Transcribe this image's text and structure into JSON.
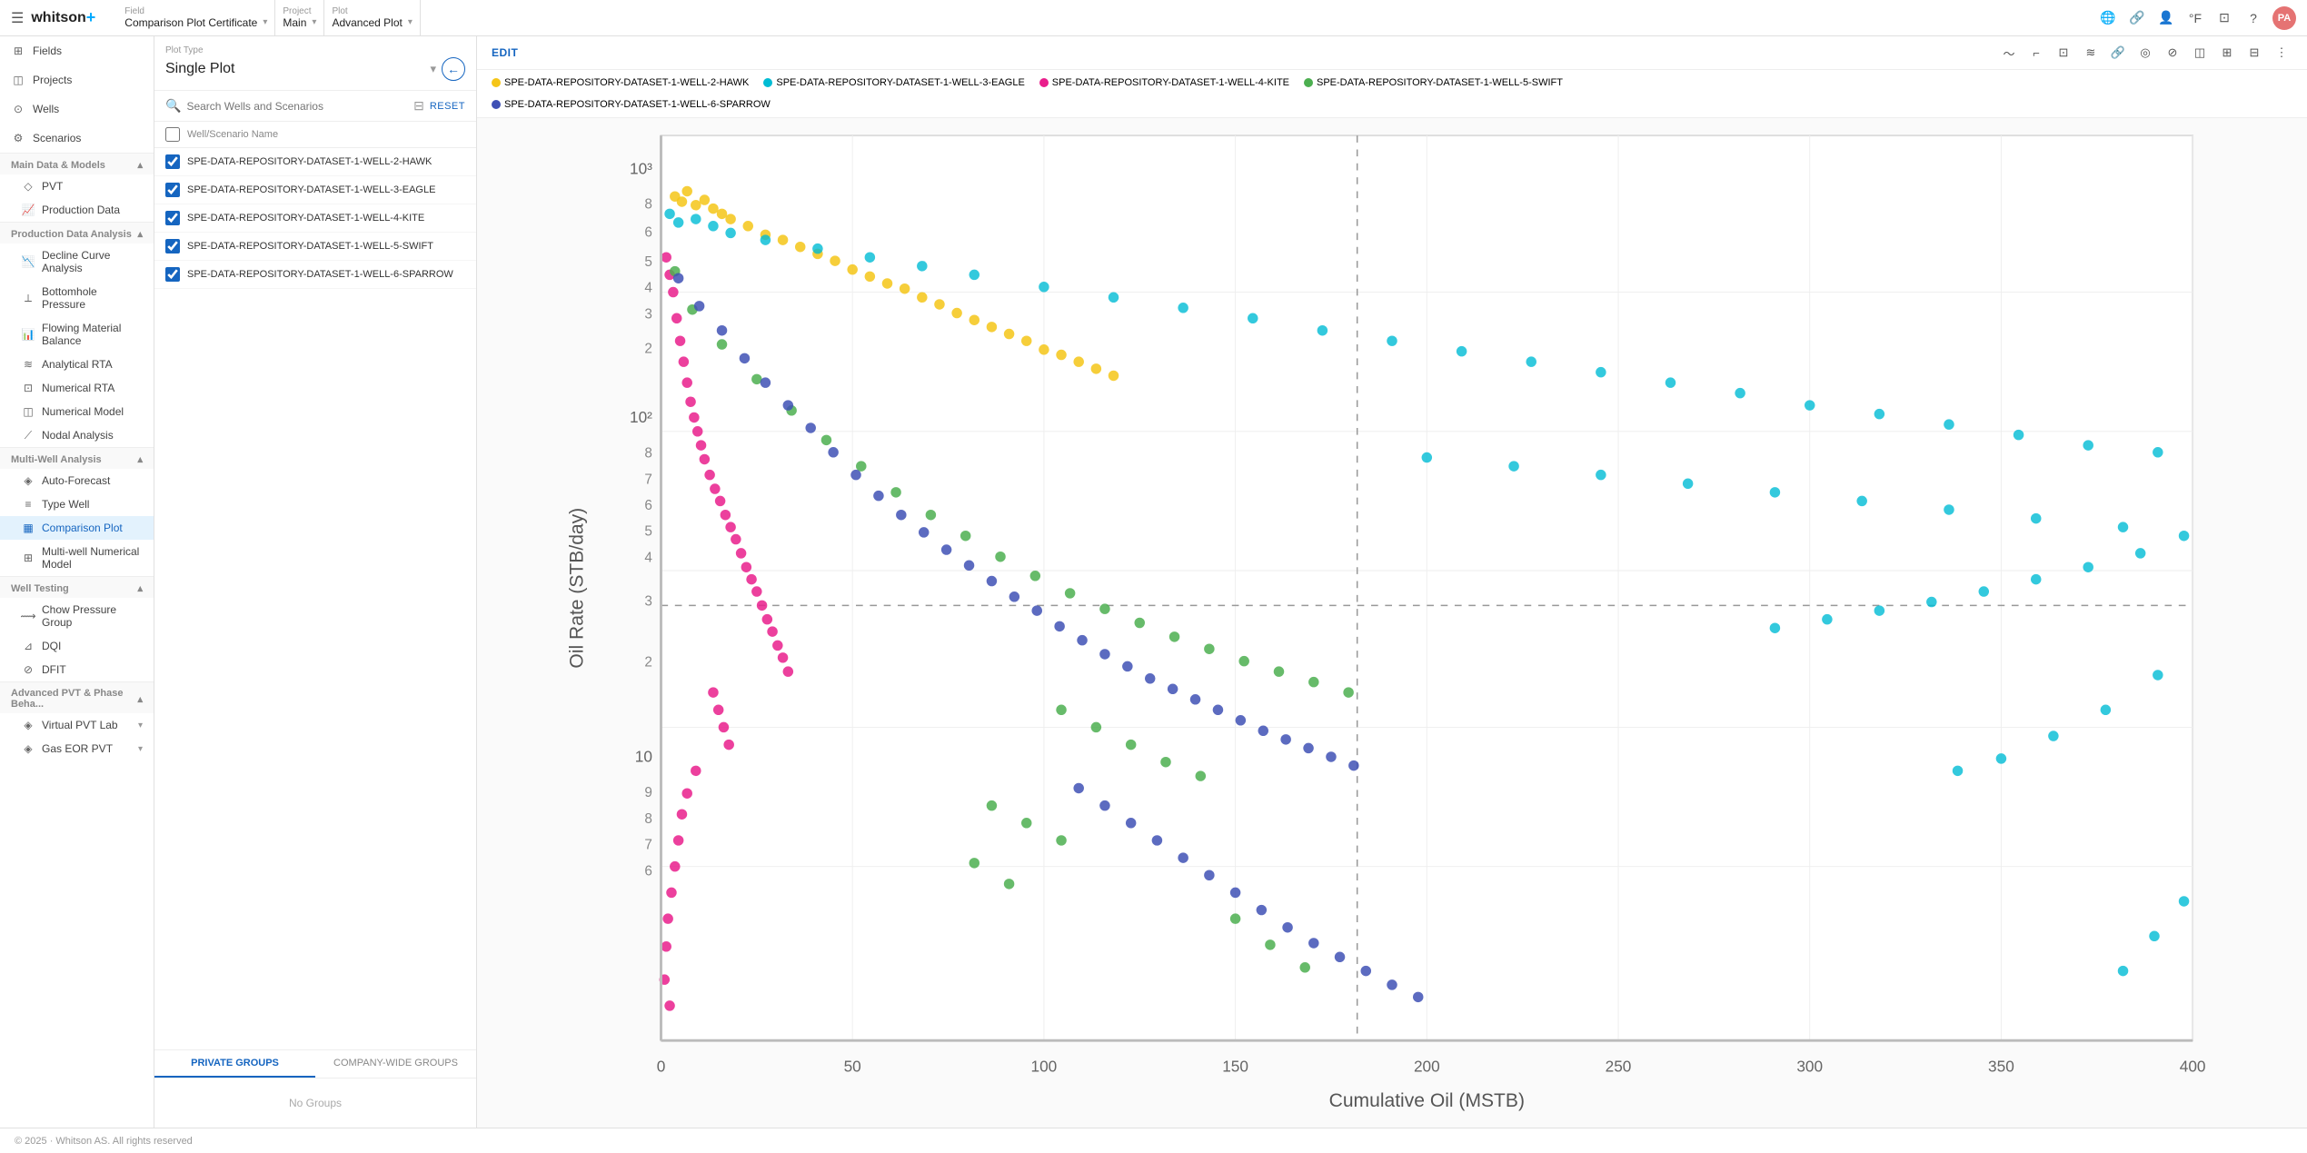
{
  "header": {
    "menu_icon": "☰",
    "logo": "whitson",
    "logo_plus": "+",
    "breadcrumbs": [
      {
        "label": "Field",
        "value": "Comparison Plot Certificate",
        "id": "field"
      },
      {
        "label": "Project",
        "value": "Main",
        "id": "project"
      },
      {
        "label": "Plot",
        "value": "Advanced Plot",
        "id": "plot"
      }
    ],
    "icons": [
      "🌐",
      "🔗",
      "👤",
      "℉",
      "☐",
      "❓"
    ],
    "avatar": "PA"
  },
  "sidebar": {
    "top_items": [
      {
        "label": "Fields",
        "icon": "⊞",
        "id": "fields"
      },
      {
        "label": "Projects",
        "icon": "📁",
        "id": "projects"
      },
      {
        "label": "Wells",
        "icon": "⊙",
        "id": "wells"
      },
      {
        "label": "Scenarios",
        "icon": "⚙",
        "id": "scenarios"
      }
    ],
    "groups": [
      {
        "label": "Main Data & Models",
        "items": [
          {
            "label": "PVT",
            "icon": "◇",
            "id": "pvt"
          },
          {
            "label": "Production Data",
            "icon": "📈",
            "id": "production-data"
          }
        ]
      },
      {
        "label": "Production Data Analysis",
        "items": [
          {
            "label": "Decline Curve Analysis",
            "icon": "📉",
            "id": "decline-curve"
          },
          {
            "label": "Bottomhole Pressure",
            "icon": "⟂",
            "id": "bottomhole-pressure"
          },
          {
            "label": "Flowing Material Balance",
            "icon": "📊",
            "id": "flowing-material-balance"
          },
          {
            "label": "Analytical RTA",
            "icon": "≋",
            "id": "analytical-rta"
          },
          {
            "label": "Numerical RTA",
            "icon": "⊡",
            "id": "numerical-rta"
          },
          {
            "label": "Numerical Model",
            "icon": "◫",
            "id": "numerical-model"
          },
          {
            "label": "Nodal Analysis",
            "icon": "⟋",
            "id": "nodal-analysis"
          }
        ]
      },
      {
        "label": "Multi-Well Analysis",
        "items": [
          {
            "label": "Auto-Forecast",
            "icon": "◈",
            "id": "auto-forecast"
          },
          {
            "label": "Type Well",
            "icon": "≡",
            "id": "type-well"
          },
          {
            "label": "Comparison Plot",
            "icon": "▦",
            "id": "comparison-plot",
            "active": true
          },
          {
            "label": "Multi-well Numerical Model",
            "icon": "⊞",
            "id": "multi-well-numerical"
          }
        ]
      },
      {
        "label": "Well Testing",
        "items": [
          {
            "label": "Chow Pressure Group",
            "icon": "⟿",
            "id": "chow-pressure"
          },
          {
            "label": "DQI",
            "icon": "⊿",
            "id": "dqi"
          },
          {
            "label": "DFIT",
            "icon": "⊘",
            "id": "dfit"
          }
        ]
      },
      {
        "label": "Advanced PVT & Phase Beha...",
        "items": [
          {
            "label": "Virtual PVT Lab",
            "icon": "◈",
            "id": "virtual-pvt",
            "collapsible": true
          },
          {
            "label": "Gas EOR PVT",
            "icon": "◈",
            "id": "gas-eor",
            "collapsible": true
          }
        ]
      }
    ]
  },
  "middle_panel": {
    "plot_type_label": "Plot Type",
    "plot_type_value": "Single Plot",
    "search_placeholder": "Search Wells and Scenarios",
    "reset_label": "RESET",
    "well_col_header": "Well/Scenario Name",
    "wells": [
      {
        "name": "SPE-DATA-REPOSITORY-DATASET-1-WELL-2-HAWK",
        "checked": true
      },
      {
        "name": "SPE-DATA-REPOSITORY-DATASET-1-WELL-3-EAGLE",
        "checked": true
      },
      {
        "name": "SPE-DATA-REPOSITORY-DATASET-1-WELL-4-KITE",
        "checked": true
      },
      {
        "name": "SPE-DATA-REPOSITORY-DATASET-1-WELL-5-SWIFT",
        "checked": true
      },
      {
        "name": "SPE-DATA-REPOSITORY-DATASET-1-WELL-6-SPARROW",
        "checked": true
      }
    ],
    "groups_tabs": [
      {
        "label": "PRIVATE GROUPS",
        "active": true
      },
      {
        "label": "COMPANY-WIDE GROUPS",
        "active": false
      }
    ],
    "no_groups_text": "No Groups"
  },
  "chart": {
    "edit_label": "EDIT",
    "legend": [
      {
        "label": "SPE-DATA-REPOSITORY-DATASET-1-WELL-2-HAWK",
        "color": "#f5c518"
      },
      {
        "label": "SPE-DATA-REPOSITORY-DATASET-1-WELL-3-EAGLE",
        "color": "#00bcd4"
      },
      {
        "label": "SPE-DATA-REPOSITORY-DATASET-1-WELL-4-KITE",
        "color": "#e91e8c"
      },
      {
        "label": "SPE-DATA-REPOSITORY-DATASET-1-WELL-5-SWIFT",
        "color": "#4caf50"
      },
      {
        "label": "SPE-DATA-REPOSITORY-DATASET-1-WELL-6-SPARROW",
        "color": "#3f51b5"
      }
    ],
    "y_axis_label": "Oil Rate (STB/day)",
    "x_axis_label": "Cumulative Oil (MSTB)",
    "x_ticks": [
      "0",
      "50",
      "100",
      "150",
      "200",
      "250",
      "300",
      "350",
      "400"
    ],
    "y_ticks_log": [
      "10",
      "10²",
      "10³"
    ],
    "tools": [
      "〜",
      "⌐",
      "⊡",
      "≋",
      "🔗",
      "◎",
      "⊘",
      "◫",
      "⊞",
      "⊟",
      "⋮"
    ]
  },
  "footer": {
    "copyright": "© 2025 · Whitson AS. All rights reserved"
  }
}
